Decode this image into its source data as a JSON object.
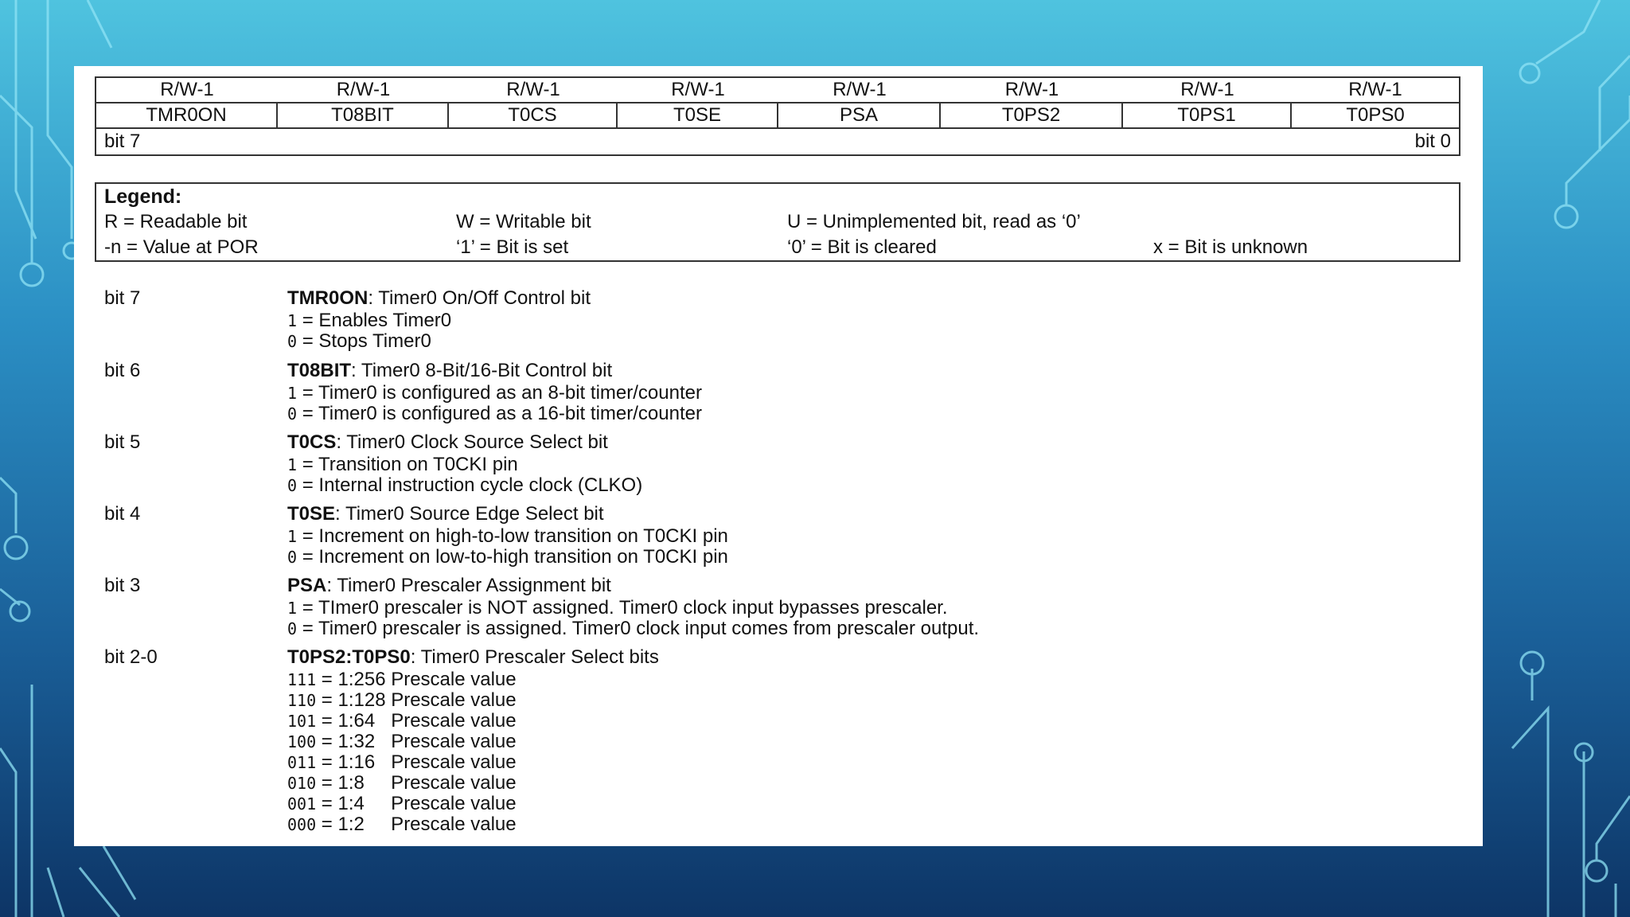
{
  "register": {
    "access": [
      "R/W-1",
      "R/W-1",
      "R/W-1",
      "R/W-1",
      "R/W-1",
      "R/W-1",
      "R/W-1",
      "R/W-1"
    ],
    "names": [
      "TMR0ON",
      "T08BIT",
      "T0CS",
      "T0SE",
      "PSA",
      "T0PS2",
      "T0PS1",
      "T0PS0"
    ],
    "msb_label": "bit 7",
    "lsb_label": "bit 0"
  },
  "legend": {
    "title": "Legend:",
    "r": "R = Readable bit",
    "w": "W = Writable bit",
    "u": "U = Unimplemented bit, read as ‘0’",
    "n": "-n = Value at POR",
    "set": "‘1’ = Bit is set",
    "cleared": "‘0’ = Bit is cleared",
    "x": "x = Bit is unknown"
  },
  "bits": [
    {
      "label": "bit 7",
      "name": "TMR0ON",
      "sep": ":",
      "desc": " Timer0 On/Off Control bit",
      "values": [
        {
          "code": "1",
          "text": " = Enables Timer0"
        },
        {
          "code": "0",
          "text": " = Stops Timer0"
        }
      ]
    },
    {
      "label": "bit 6",
      "name": "T08BIT",
      "sep": ":",
      "desc": " Timer0 8-Bit/16-Bit Control bit",
      "values": [
        {
          "code": "1",
          "text": " = Timer0 is configured as an 8-bit timer/counter"
        },
        {
          "code": "0",
          "text": " = Timer0 is configured as a 16-bit timer/counter"
        }
      ]
    },
    {
      "label": "bit 5",
      "name": "T0CS",
      "sep": ":",
      "desc": " Timer0 Clock Source Select bit",
      "values": [
        {
          "code": "1",
          "text": " = Transition on T0CKI pin"
        },
        {
          "code": "0",
          "text": " = Internal instruction cycle clock (CLKO)"
        }
      ]
    },
    {
      "label": "bit 4",
      "name": "T0SE",
      "sep": ":",
      "desc": " Timer0 Source Edge Select bit",
      "values": [
        {
          "code": "1",
          "text": " = Increment on high-to-low transition on T0CKI pin"
        },
        {
          "code": "0",
          "text": " = Increment on low-to-high transition on T0CKI pin"
        }
      ]
    },
    {
      "label": "bit 3",
      "name": "PSA",
      "sep": ":",
      "desc": " Timer0 Prescaler Assignment bit",
      "values": [
        {
          "code": "1",
          "text": " = TImer0 prescaler is NOT assigned. Timer0 clock input bypasses prescaler."
        },
        {
          "code": "0",
          "text": " = Timer0 prescaler is assigned. Timer0 clock input comes from prescaler output."
        }
      ]
    },
    {
      "label": "bit 2-0",
      "name": "T0PS2:T0PS0",
      "sep": ":",
      "desc": " Timer0 Prescaler Select bits",
      "values": [
        {
          "code": "111",
          "text": " = 1:256 Prescale value"
        },
        {
          "code": "110",
          "text": " = 1:128 Prescale value"
        },
        {
          "code": "101",
          "text": " = 1:64   Prescale value"
        },
        {
          "code": "100",
          "text": " = 1:32   Prescale value"
        },
        {
          "code": "011",
          "text": " = 1:16   Prescale value"
        },
        {
          "code": "010",
          "text": " = 1:8     Prescale value"
        },
        {
          "code": "001",
          "text": " = 1:4     Prescale value"
        },
        {
          "code": "000",
          "text": " = 1:2     Prescale value"
        }
      ]
    }
  ]
}
